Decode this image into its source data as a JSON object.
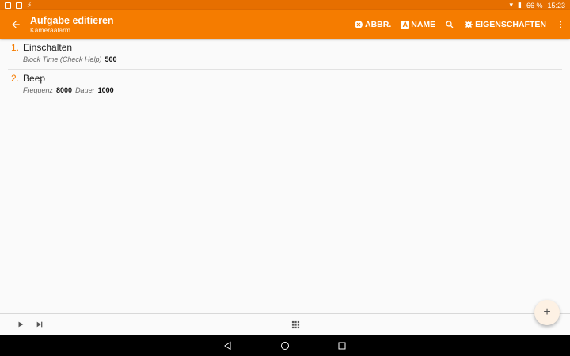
{
  "status_bar": {
    "battery": "66 %",
    "time": "15:23"
  },
  "app_bar": {
    "title": "Aufgabe editieren",
    "subtitle": "Kameraalarm",
    "actions": {
      "abort": "ABBR.",
      "name": "NAME",
      "properties": "EIGENSCHAFTEN"
    }
  },
  "actions_list": [
    {
      "number": "1.",
      "name": "Einschalten",
      "params": [
        {
          "label": "Block Time (Check Help)",
          "value": "500"
        }
      ]
    },
    {
      "number": "2.",
      "name": "Beep",
      "params": [
        {
          "label": "Frequenz",
          "value": "8000"
        },
        {
          "label": "Dauer",
          "value": "1000"
        }
      ]
    }
  ],
  "icons": {
    "back": "arrow-left-icon",
    "abort": "cancel-circle-icon",
    "name": "letter-a-icon",
    "search": "search-icon",
    "properties": "gear-icon",
    "more": "more-vert-icon",
    "play": "play-icon",
    "step": "skip-next-icon",
    "apps": "grid-icon",
    "add": "plus-icon"
  },
  "colors": {
    "primary": "#f57c00",
    "status_bar": "#e66f00",
    "accent_number": "#f57c00"
  }
}
